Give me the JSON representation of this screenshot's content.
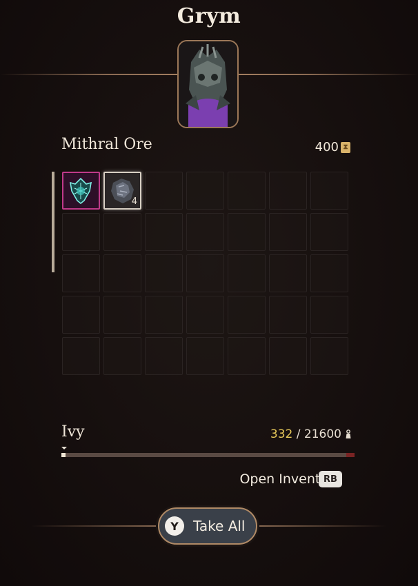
{
  "container": {
    "title": "Grym",
    "portrait_icon": "grym-portrait-icon"
  },
  "selected_item": {
    "name": "Mithral Ore",
    "value": "400",
    "value_icon": "gold-coin-icon"
  },
  "grid": {
    "columns": 7,
    "rows": 5,
    "items": [
      {
        "slot": 0,
        "icon": "glowing-heart-relic-icon",
        "rarity_color": "#c03a8a",
        "qty": ""
      },
      {
        "slot": 1,
        "icon": "mithral-ore-icon",
        "rarity_color": "#d8d0c4",
        "qty": "4"
      }
    ]
  },
  "character": {
    "name": "Ivy",
    "weight_current": "332",
    "weight_separator": "/",
    "weight_max": "21600",
    "weight_icon": "weight-icon",
    "weight_fraction": 0.015
  },
  "actions": {
    "open_inventory_label": "Open Inventory",
    "open_inventory_key": "RB",
    "take_all_label": "Take All",
    "take_all_key": "Y"
  },
  "colors": {
    "accent_frame": "#9c7858",
    "weight_current": "#e6c85a",
    "button_bg": "#3a4049"
  }
}
